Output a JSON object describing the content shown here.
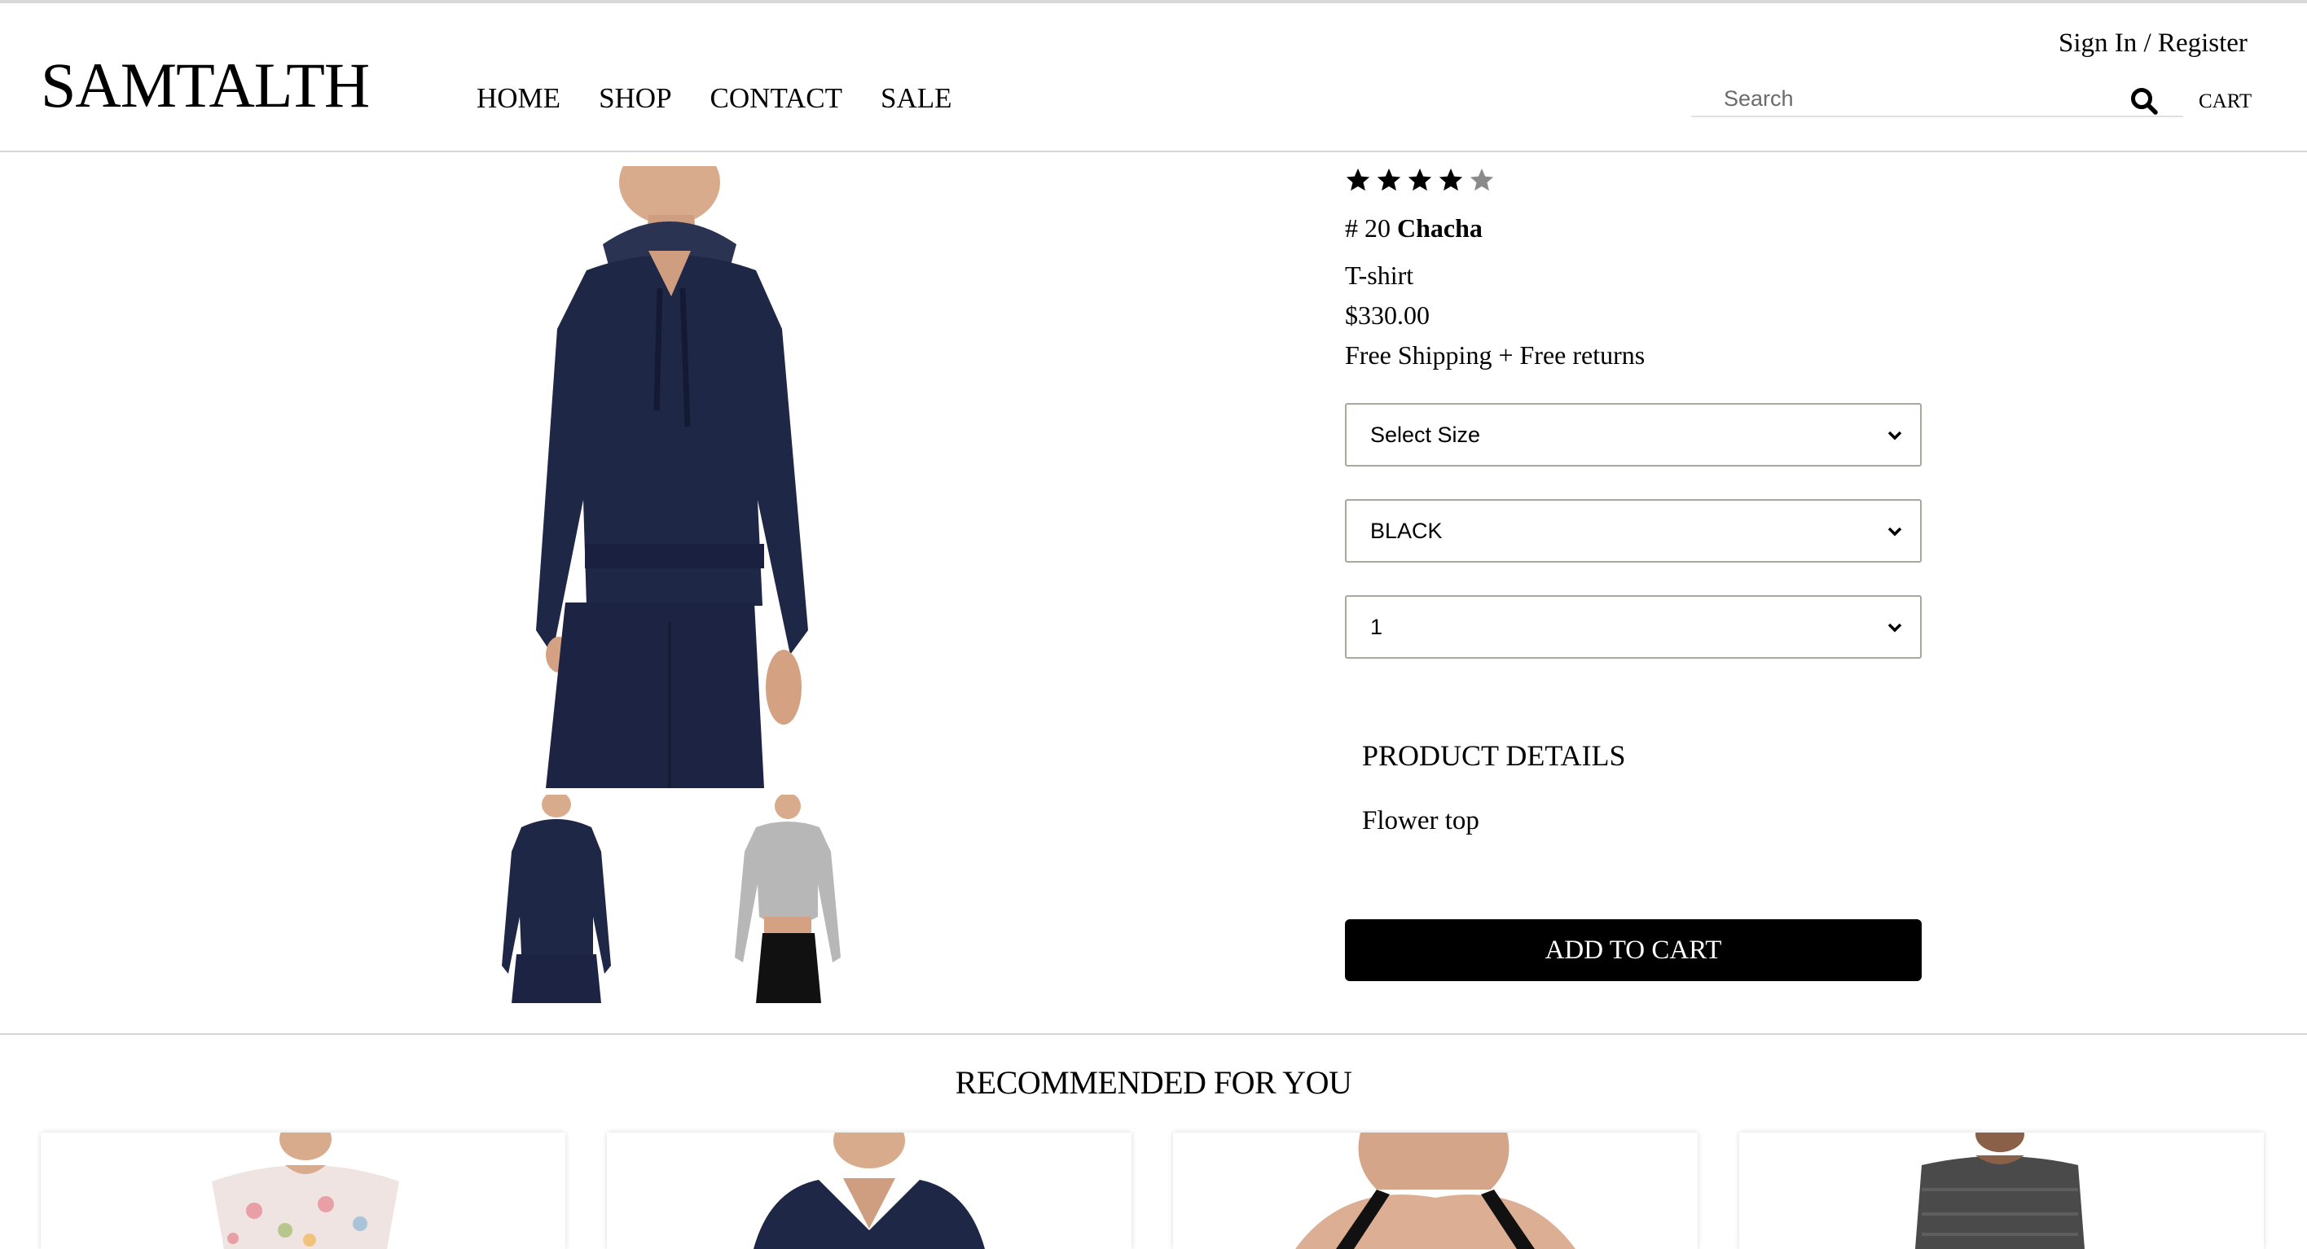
{
  "header": {
    "logo": "SAMTALTH",
    "nav": [
      "HOME",
      "SHOP",
      "CONTACT",
      "SALE"
    ],
    "signin": "Sign In / Register",
    "search_placeholder": "Search",
    "cart": "CART"
  },
  "product": {
    "rating": 4,
    "rating_max": 5,
    "id_prefix": "# 20",
    "name": "Chacha",
    "type": "T-shirt",
    "price": "$330.00",
    "shipping": "Free Shipping + Free returns",
    "size_select": "Select Size",
    "color_select": "BLACK",
    "qty_select": "1",
    "details_title": "PRODUCT DETAILS",
    "details_text": "Flower top",
    "add_to_cart": "ADD TO CART"
  },
  "recommended": {
    "title": "RECOMMENDED FOR YOU"
  },
  "colors": {
    "navy": "#1f2746",
    "black": "#000000",
    "grey_top": "#b7b7b7",
    "star_empty": "#8a8a8a"
  }
}
